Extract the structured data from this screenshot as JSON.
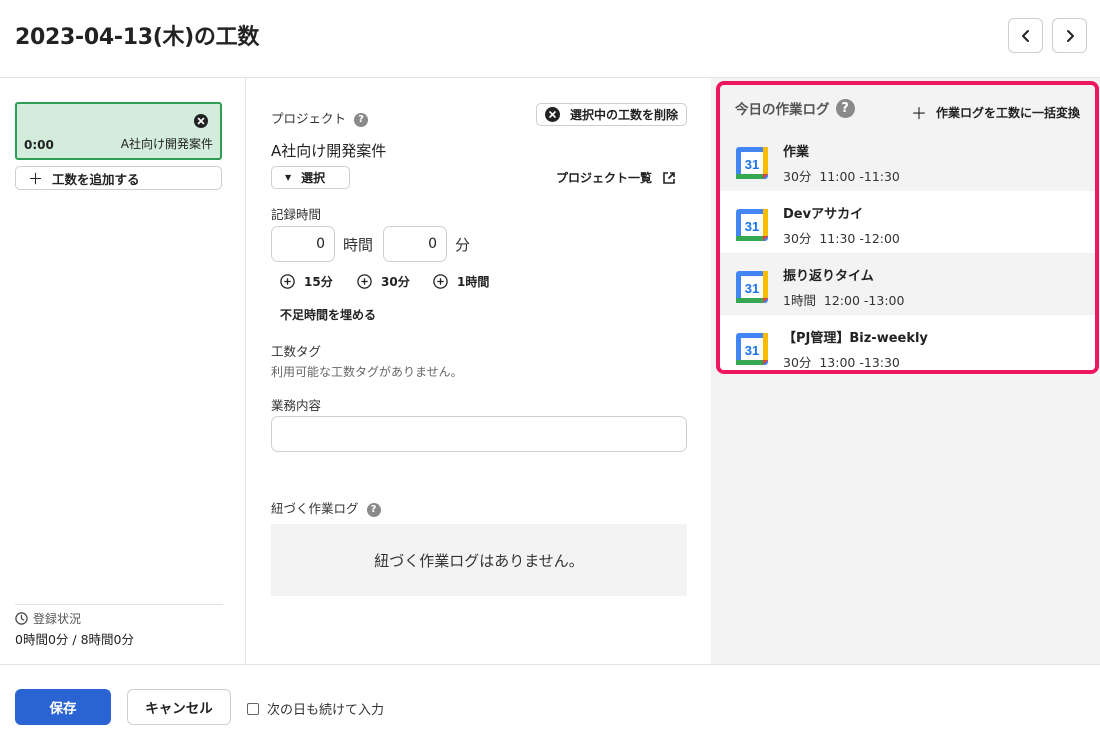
{
  "header": {
    "title": "2023-04-13(木)の工数"
  },
  "left": {
    "entry": {
      "time": "0:00",
      "project": "A社向け開発案件"
    },
    "add_entry_label": "工数を追加する",
    "status_label": "登録状況",
    "status_value": "0時間0分 / 8時間0分"
  },
  "form": {
    "project_label": "プロジェクト",
    "delete_selected_label": "選択中の工数を削除",
    "project_name": "A社向け開発案件",
    "select_label": "選択",
    "project_list_label": "プロジェクト一覧",
    "record_time_label": "記録時間",
    "hours_value": "0",
    "hours_unit": "時間",
    "minutes_value": "0",
    "minutes_unit": "分",
    "quick_add": [
      "15分",
      "30分",
      "1時間"
    ],
    "fill_shortage_label": "不足時間を埋める",
    "tag_label": "工数タグ",
    "tag_empty": "利用可能な工数タグがありません。",
    "content_label": "業務内容",
    "content_value": "",
    "linked_log_label": "紐づく作業ログ",
    "linked_log_empty": "紐づく作業ログはありません。"
  },
  "today_log": {
    "title": "今日の作業ログ",
    "convert_label": "作業ログを工数に一括変換",
    "calendar_day": "31",
    "items": [
      {
        "name": "作業",
        "duration": "30分",
        "range": "11:00 -11:30"
      },
      {
        "name": "Devアサカイ",
        "duration": "30分",
        "range": "11:30 -12:00"
      },
      {
        "name": "振り返りタイム",
        "duration": "1時間",
        "range": "12:00 -13:00"
      },
      {
        "name": "【PJ管理】Biz-weekly",
        "duration": "30分",
        "range": "13:00 -13:30"
      }
    ]
  },
  "footer": {
    "save_label": "保存",
    "cancel_label": "キャンセル",
    "continue_label": "次の日も続けて入力",
    "continue_checked": false
  },
  "colors": {
    "primary": "#2a64d2",
    "entry_bg": "#d3ecdb",
    "entry_border": "#2e9e55",
    "highlight_border": "#ee1561",
    "panel_bg": "#f4f3f4"
  }
}
